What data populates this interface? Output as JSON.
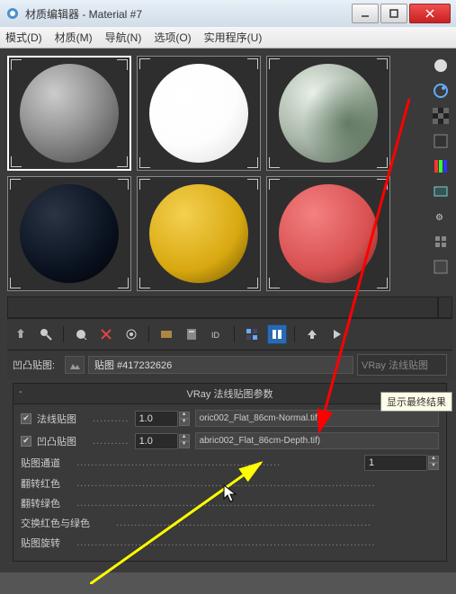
{
  "window": {
    "title": "材质编辑器 - Material #7"
  },
  "menu": {
    "mode": "模式(D)",
    "material": "材质(M)",
    "navigate": "导航(N)",
    "options": "选项(O)",
    "utilities": "实用程序(U)"
  },
  "maprow": {
    "label": "凹凸贴图:",
    "mapname": "贴图 #417232626",
    "maptype": "VRay 法线贴图"
  },
  "tooltip": "显示最终结果",
  "rollout": {
    "title": "VRay 法线贴图参数",
    "normal": {
      "label": "法线贴图",
      "value": "1.0",
      "map": "oric002_Flat_86cm-Normal.tif)"
    },
    "bump": {
      "label": "凹凸贴图",
      "value": "1.0",
      "map": "abric002_Flat_86cm-Depth.tif)"
    },
    "channel": {
      "label": "贴图通道",
      "value": "1"
    },
    "flipred": {
      "label": "翻转红色"
    },
    "flipgreen": {
      "label": "翻转绿色"
    },
    "swaprg": {
      "label": "交换红色与绿色"
    },
    "rotate": {
      "label": "贴图旋转"
    }
  }
}
